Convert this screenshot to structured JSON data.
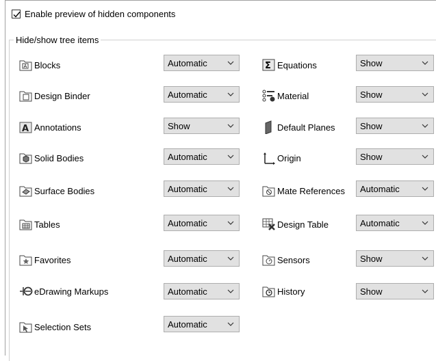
{
  "enable_preview": {
    "label": "Enable preview of hidden components",
    "checked": true
  },
  "group_title": "Hide/show tree items",
  "left_column": [
    {
      "label": "Blocks",
      "icon": "blocks-folder-icon",
      "value": "Automatic"
    },
    {
      "label": "Design Binder",
      "icon": "design-binder-folder-icon",
      "value": "Automatic"
    },
    {
      "label": "Annotations",
      "icon": "annotations-icon",
      "value": "Show"
    },
    {
      "label": "Solid Bodies",
      "icon": "solid-bodies-folder-icon",
      "value": "Automatic"
    },
    {
      "label": "Surface Bodies",
      "icon": "surface-bodies-folder-icon",
      "value": "Automatic"
    },
    {
      "label": "Tables",
      "icon": "tables-folder-icon",
      "value": "Automatic"
    },
    {
      "label": "Favorites",
      "icon": "favorites-folder-icon",
      "value": "Automatic"
    },
    {
      "label": "eDrawing Markups",
      "icon": "edrawing-markups-icon",
      "value": "Automatic"
    },
    {
      "label": "Selection Sets",
      "icon": "selection-sets-folder-icon",
      "value": "Automatic"
    }
  ],
  "right_column": [
    {
      "label": "Equations",
      "icon": "equations-sigma-icon",
      "value": "Show"
    },
    {
      "label": "Material",
      "icon": "material-icon",
      "value": "Show"
    },
    {
      "label": "Default Planes",
      "icon": "default-planes-icon",
      "value": "Show"
    },
    {
      "label": "Origin",
      "icon": "origin-axes-icon",
      "value": "Show"
    },
    {
      "label": "Mate References",
      "icon": "mate-references-folder-icon",
      "value": "Automatic"
    },
    {
      "label": "Design Table",
      "icon": "design-table-icon",
      "value": "Automatic"
    },
    {
      "label": "Sensors",
      "icon": "sensors-folder-icon",
      "value": "Show"
    },
    {
      "label": "History",
      "icon": "history-folder-icon",
      "value": "Show"
    }
  ]
}
